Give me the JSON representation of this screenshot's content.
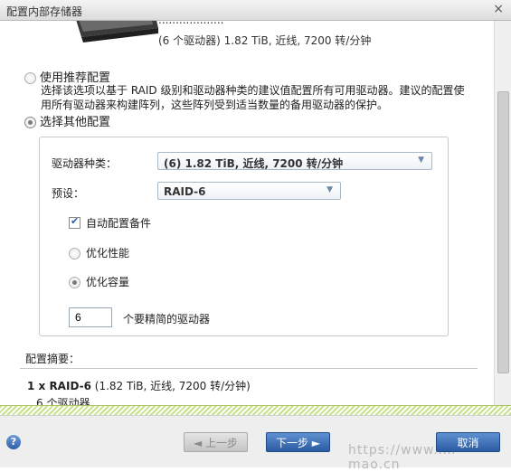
{
  "window": {
    "title": "配置内部存储器",
    "close_glyph": "×"
  },
  "drive": {
    "name_partial": "...................",
    "detail": "(6 个驱动器) 1.82 TiB, 近线, 7200 转/分钟"
  },
  "options": {
    "recommended": {
      "label": "使用推荐配置",
      "description": "选择该选项以基于 RAID 级别和驱动器种类的建议值配置所有可用驱动器。建议的配置使用所有驱动器来构建阵列，这些阵列受到适当数量的备用驱动器的保护。",
      "selected": false
    },
    "other": {
      "label": "选择其他配置",
      "selected": true
    }
  },
  "form": {
    "drive_type_label": "驱动器种类：",
    "drive_type_value": "(6) 1.82 TiB, 近线, 7200 转/分钟",
    "preset_label": "预设：",
    "preset_value": "RAID-6",
    "auto_spare_label": "自动配置备件",
    "auto_spare_checked": true,
    "optimize_performance_label": "优化性能",
    "optimize_capacity_label": "优化容量",
    "optimize_selected": "capacity",
    "drive_count_value": "6",
    "drive_count_label": "个要精简的驱动器"
  },
  "summary": {
    "title": "配置摘要：",
    "line1_bold": "1 x RAID-6",
    "line1_rest": " (1.82 TiB, 近线, 7200 转/分钟)",
    "line2": "6 个驱动器"
  },
  "footer": {
    "help_glyph": "?",
    "back_label": "◄ 上一步",
    "next_label": "下一步 ►",
    "cancel_label": "取消",
    "back_enabled": false
  },
  "watermark": "https://www.mi-mao.cn",
  "colors": {
    "primary_button": "#2b5ba2",
    "hatch": "#c9e08b"
  }
}
